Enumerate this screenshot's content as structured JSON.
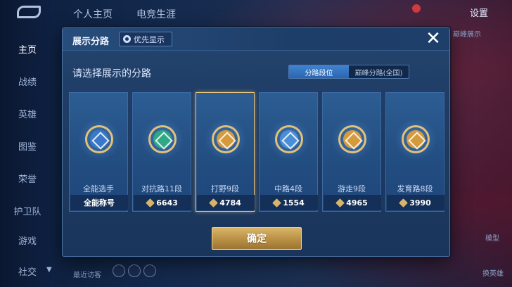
{
  "background": {
    "nav": [
      {
        "label": "主页"
      },
      {
        "label": "战绩"
      },
      {
        "label": "英雄"
      },
      {
        "label": "图鉴"
      },
      {
        "label": "荣誉"
      },
      {
        "label": "护卫队"
      },
      {
        "label": "游戏"
      },
      {
        "label": "社交"
      }
    ],
    "top_tabs": [
      "个人主页",
      "电竞生涯"
    ],
    "settings_label": "设置",
    "side_text": "巅峰展示",
    "bottom_text": "最近访客",
    "right_labels": [
      "模型",
      "换英雄"
    ]
  },
  "modal": {
    "title": "展示分路",
    "priority_label": "优先显示",
    "close_icon": "close-icon",
    "prompt": "请选择展示的分路",
    "segments": [
      {
        "label": "分路段位",
        "active": true
      },
      {
        "label": "巅峰分路(全国)",
        "active": false
      }
    ],
    "cards": [
      {
        "name": "全能选手",
        "stat": "全能称号",
        "color": "#3a78c9",
        "has_icon": false
      },
      {
        "name": "对抗路11段",
        "stat": "6643",
        "color": "#2fa886",
        "has_icon": true
      },
      {
        "name": "打野9段",
        "stat": "4784",
        "color": "#d49a3c",
        "has_icon": true,
        "selected": true
      },
      {
        "name": "中路4段",
        "stat": "1554",
        "color": "#4a8fd6",
        "has_icon": true
      },
      {
        "name": "游走9段",
        "stat": "4965",
        "color": "#d49a3c",
        "has_icon": true
      },
      {
        "name": "发育路8段",
        "stat": "3990",
        "color": "#d49a3c",
        "has_icon": true
      }
    ],
    "confirm_label": "确定"
  }
}
